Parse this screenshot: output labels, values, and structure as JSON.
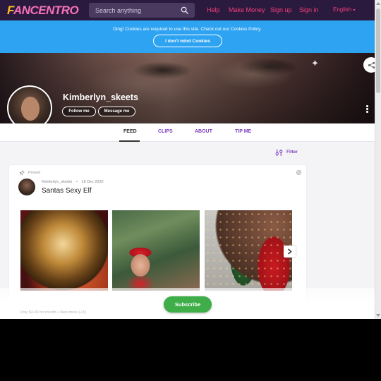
{
  "brand": {
    "logo_f": "F",
    "logo_rest": "ANCENTRO"
  },
  "search": {
    "placeholder": "Search anything"
  },
  "nav": {
    "help": "Help",
    "make_money": "Make Money",
    "sign_up": "Sign up",
    "sign_in": "Sign in",
    "language": "English"
  },
  "cookie": {
    "message": "Ding! Cookies are required to use this site. Check out our Cookies Policy.",
    "button": "I don't mind Cookies"
  },
  "profile": {
    "username": "Kimberlyn_skeets",
    "follow": "Follow me",
    "message": "Message me"
  },
  "tabs": [
    {
      "label": "FEED",
      "active": true
    },
    {
      "label": "CLIPS",
      "active": false
    },
    {
      "label": "ABOUT",
      "active": false
    },
    {
      "label": "TIP ME",
      "active": false
    }
  ],
  "feed": {
    "filter": "Filter"
  },
  "post": {
    "pinned": "Pinned",
    "author": "Kimberlyn_skeets",
    "separator": "•",
    "date": "18 Dec 2020",
    "title": "Santas Sexy Elf",
    "under_text": "Only $4.99 for month • View more (+3)"
  },
  "cta": {
    "subscribe": "Subscribe"
  },
  "colors": {
    "nav_bg": "#2a1a3d",
    "accent_pink": "#f43f7a",
    "cookie_blue": "#2ea3f2",
    "tab_purple": "#7b3fbf",
    "subscribe_green": "#3fae49"
  },
  "icons": {
    "search": "search-icon",
    "share": "share-icon",
    "more": "kebab-icon",
    "filter": "filter-icon",
    "pin": "pin-icon",
    "visibility": "globe-icon",
    "next": "chevron-right-icon"
  }
}
